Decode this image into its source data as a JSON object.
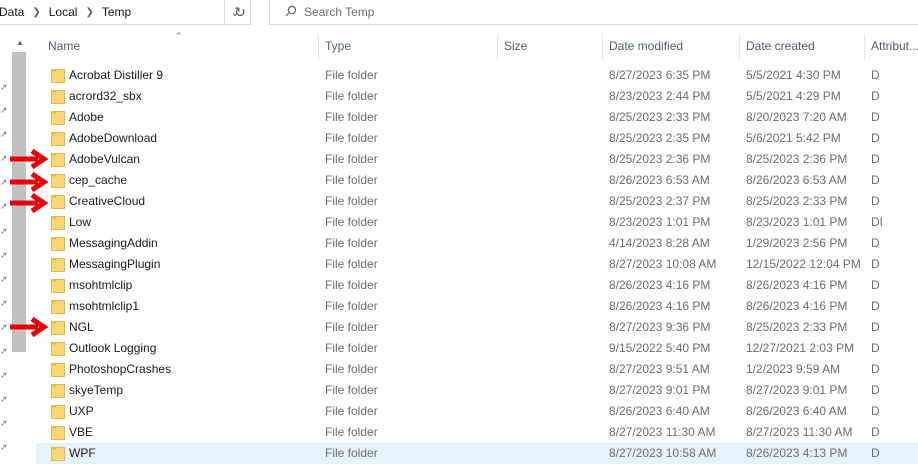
{
  "address": {
    "crumbs": [
      "Data",
      "Local",
      "Temp"
    ]
  },
  "search": {
    "placeholder": "Search Temp"
  },
  "columns": {
    "name": "Name",
    "type": "Type",
    "size": "Size",
    "date_modified": "Date modified",
    "date_created": "Date created",
    "attributes": "Attribut..."
  },
  "rows": [
    {
      "name": "Acrobat Distiller 9",
      "type": "File folder",
      "modified": "8/27/2023 6:35 PM",
      "created": "5/5/2021 4:30 PM",
      "attr": "D"
    },
    {
      "name": "acrord32_sbx",
      "type": "File folder",
      "modified": "8/23/2023 2:44 PM",
      "created": "5/5/2021 4:29 PM",
      "attr": "D"
    },
    {
      "name": "Adobe",
      "type": "File folder",
      "modified": "8/25/2023 2:33 PM",
      "created": "8/20/2023 7:20 AM",
      "attr": "D"
    },
    {
      "name": "AdobeDownload",
      "type": "File folder",
      "modified": "8/25/2023 2:35 PM",
      "created": "5/6/2021 5:42 PM",
      "attr": "D"
    },
    {
      "name": "AdobeVulcan",
      "type": "File folder",
      "modified": "8/25/2023 2:36 PM",
      "created": "8/25/2023 2:36 PM",
      "attr": "D"
    },
    {
      "name": "cep_cache",
      "type": "File folder",
      "modified": "8/26/2023 6:53 AM",
      "created": "8/26/2023 6:53 AM",
      "attr": "D"
    },
    {
      "name": "CreativeCloud",
      "type": "File folder",
      "modified": "8/25/2023 2:37 PM",
      "created": "8/25/2023 2:33 PM",
      "attr": "D"
    },
    {
      "name": "Low",
      "type": "File folder",
      "modified": "8/23/2023 1:01 PM",
      "created": "8/23/2023 1:01 PM",
      "attr": "DI"
    },
    {
      "name": "MessagingAddin",
      "type": "File folder",
      "modified": "4/14/2023 8:28 AM",
      "created": "1/29/2023 2:56 PM",
      "attr": "D"
    },
    {
      "name": "MessagingPlugin",
      "type": "File folder",
      "modified": "8/27/2023 10:08 AM",
      "created": "12/15/2022 12:04 PM",
      "attr": "D"
    },
    {
      "name": "msohtmlclip",
      "type": "File folder",
      "modified": "8/26/2023 4:16 PM",
      "created": "8/26/2023 4:16 PM",
      "attr": "D"
    },
    {
      "name": "msohtmlclip1",
      "type": "File folder",
      "modified": "8/26/2023 4:16 PM",
      "created": "8/26/2023 4:16 PM",
      "attr": "D"
    },
    {
      "name": "NGL",
      "type": "File folder",
      "modified": "8/27/2023 9:36 PM",
      "created": "8/25/2023 2:33 PM",
      "attr": "D"
    },
    {
      "name": "Outlook Logging",
      "type": "File folder",
      "modified": "9/15/2022 5:40 PM",
      "created": "12/27/2021 2:03 PM",
      "attr": "D"
    },
    {
      "name": "PhotoshopCrashes",
      "type": "File folder",
      "modified": "8/27/2023 9:51 AM",
      "created": "1/2/2023 9:59 AM",
      "attr": "D"
    },
    {
      "name": "skyeTemp",
      "type": "File folder",
      "modified": "8/27/2023 9:01 PM",
      "created": "8/27/2023 9:01 PM",
      "attr": "D"
    },
    {
      "name": "UXP",
      "type": "File folder",
      "modified": "8/26/2023 6:40 AM",
      "created": "8/26/2023 6:40 AM",
      "attr": "D"
    },
    {
      "name": "VBE",
      "type": "File folder",
      "modified": "8/27/2023 11:30 AM",
      "created": "8/27/2023 11:30 AM",
      "attr": "D"
    },
    {
      "name": "WPF",
      "type": "File folder",
      "modified": "8/27/2023 10:58 AM",
      "created": "8/26/2023 4:13 PM",
      "attr": "D"
    }
  ],
  "icons": {
    "folder": "folder-icon",
    "search": "search-icon",
    "refresh": "refresh-icon",
    "dropdown": "chevron-down-icon",
    "breadcrumb_separator": "chevron-right-icon",
    "pin": "pin-icon",
    "annotation_arrow": "red-arrow-icon"
  },
  "colors": {
    "folder": "#f8d775",
    "folder_dark": "#e0b94a",
    "header_text": "#4c607a",
    "selected_row": "#e5f3ff",
    "annotation": "#e8000a"
  }
}
